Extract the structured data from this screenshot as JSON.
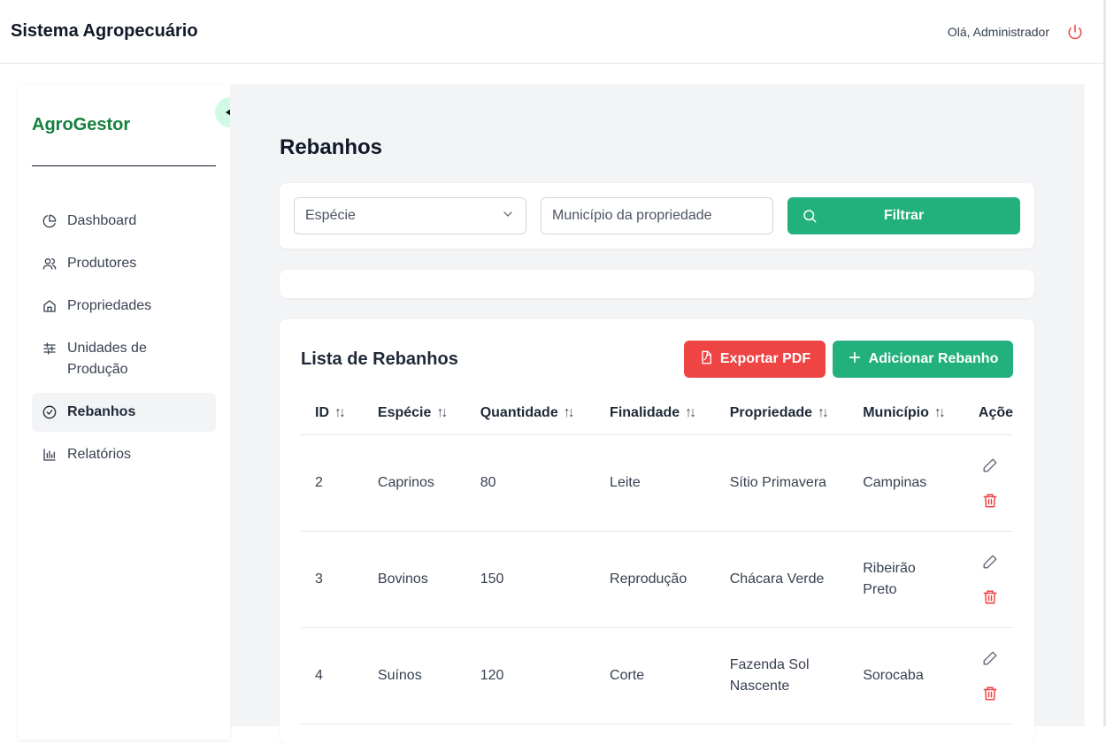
{
  "header": {
    "title": "Sistema Agropecuário",
    "greeting": "Olá, Administrador"
  },
  "sidebar": {
    "brand": "AgroGestor",
    "items": [
      {
        "label": "Dashboard",
        "icon": "pie-chart-icon"
      },
      {
        "label": "Produtores",
        "icon": "users-icon"
      },
      {
        "label": "Propriedades",
        "icon": "home-icon"
      },
      {
        "label": "Unidades de Produção",
        "icon": "sliders-icon"
      },
      {
        "label": "Rebanhos",
        "icon": "check-circle-icon",
        "active": true
      },
      {
        "label": "Relatórios",
        "icon": "bar-chart-icon"
      }
    ]
  },
  "page": {
    "title": "Rebanhos"
  },
  "filters": {
    "species_placeholder": "Espécie",
    "municipality_placeholder": "Município da propriedade",
    "filter_button": "Filtrar"
  },
  "list": {
    "title": "Lista de Rebanhos",
    "export_button": "Exportar PDF",
    "add_button": "Adicionar Rebanho",
    "columns": [
      "ID",
      "Espécie",
      "Quantidade",
      "Finalidade",
      "Propriedade",
      "Município",
      "Ações"
    ],
    "rows": [
      {
        "id": "2",
        "especie": "Caprinos",
        "quantidade": "80",
        "finalidade": "Leite",
        "propriedade": "Sítio Primavera",
        "municipio": "Campinas"
      },
      {
        "id": "3",
        "especie": "Bovinos",
        "quantidade": "150",
        "finalidade": "Reprodução",
        "propriedade": "Chácara Verde",
        "municipio": "Ribeirão Preto"
      },
      {
        "id": "4",
        "especie": "Suínos",
        "quantidade": "120",
        "finalidade": "Corte",
        "propriedade": "Fazenda Sol Nascente",
        "municipio": "Sorocaba"
      }
    ]
  },
  "colors": {
    "primary": "#22b07d",
    "danger": "#ef4444",
    "brand": "#15803d"
  }
}
